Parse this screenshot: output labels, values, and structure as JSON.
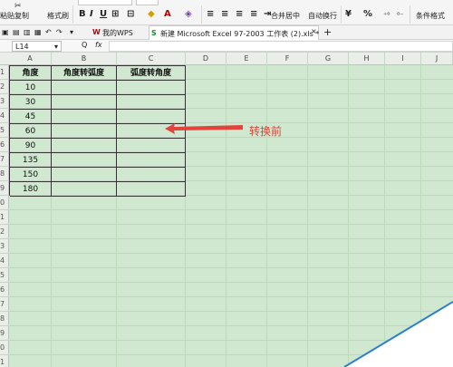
{
  "toolbar": {
    "paste_label": "粘贴",
    "copy_label": "复制",
    "format_painter_label": "格式刷",
    "bold": "B",
    "italic": "I",
    "underline": "U",
    "merge_center_label": "合并居中",
    "wrap_text_label": "自动换行",
    "currency_symbol": "¥",
    "percent_symbol": "%",
    "conditional_format_label": "条件格式"
  },
  "tabs": {
    "my_wps": "我的WPS",
    "document": "新建 Microsoft Excel 97-2003 工作表 (2).xls *",
    "close": "×",
    "add": "+"
  },
  "formula_bar": {
    "name_box": "L14",
    "zoom_symbol": "Q",
    "fx_label": "fx"
  },
  "sheet": {
    "column_letters": [
      "A",
      "B",
      "C",
      "D",
      "E",
      "F",
      "G",
      "H",
      "I",
      "J"
    ],
    "row_numbers": [
      "1",
      "2",
      "3",
      "4",
      "5",
      "6",
      "7",
      "8",
      "9",
      "0",
      "1",
      "2",
      "3",
      "4",
      "5",
      "6",
      "7",
      "8",
      "9",
      "0",
      "1"
    ],
    "table": {
      "headers": [
        "角度",
        "角度转弧度",
        "弧度转角度"
      ],
      "rows": [
        [
          "10",
          "",
          ""
        ],
        [
          "30",
          "",
          ""
        ],
        [
          "45",
          "",
          ""
        ],
        [
          "60",
          "",
          ""
        ],
        [
          "90",
          "",
          ""
        ],
        [
          "135",
          "",
          ""
        ],
        [
          "150",
          "",
          ""
        ],
        [
          "180",
          "",
          ""
        ]
      ]
    }
  },
  "annotation": {
    "label": "转换前",
    "color": "#e0443a"
  },
  "colors": {
    "sheet_background": "#cfe8cf",
    "gridline": "#bcd9bc"
  }
}
